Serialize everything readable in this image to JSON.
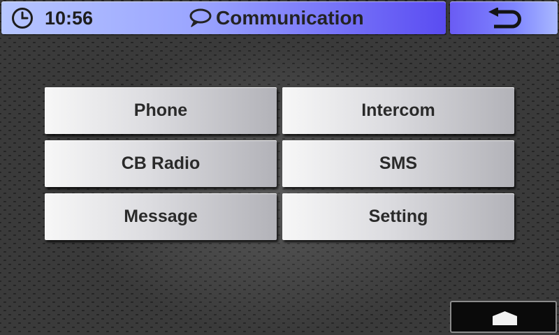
{
  "header": {
    "time": "10:56",
    "title": "Communication",
    "clock_icon": "clock-icon",
    "title_icon": "chat-bubble-icon"
  },
  "navigation": {
    "back_icon": "back-arrow-icon",
    "home_icon": "home-icon"
  },
  "menu": {
    "items": [
      {
        "label": "Phone"
      },
      {
        "label": "Intercom"
      },
      {
        "label": "CB Radio"
      },
      {
        "label": "SMS"
      },
      {
        "label": "Message"
      },
      {
        "label": "Setting"
      }
    ]
  },
  "colors": {
    "header_start": "#b6c6ff",
    "header_end": "#5a4cf2",
    "button_light": "#f7f7f7",
    "button_dark": "#b2b2b8",
    "background": "#222222"
  }
}
